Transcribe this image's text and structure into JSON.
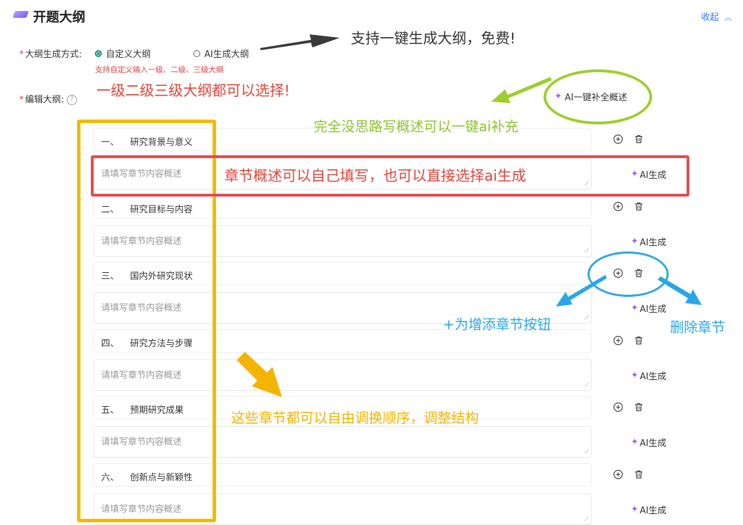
{
  "header": {
    "title": "开题大纲",
    "collapse_label": "收起"
  },
  "form": {
    "gen_mode_label": "大纲生成方式:",
    "option_custom": "自定义大纲",
    "option_ai": "AI生成大纲",
    "custom_hint": "支持自定义输入一级、二级、三级大纲",
    "edit_label": "编辑大纲:",
    "help_glyph": "?",
    "ai_complete_label": "AI一键补全概述"
  },
  "sections": [
    {
      "index": "一、",
      "title": "研究背景与意义"
    },
    {
      "index": "二、",
      "title": "研究目标与内容"
    },
    {
      "index": "三、",
      "title": "国内外研究现状"
    },
    {
      "index": "四、",
      "title": "研究方法与步骤"
    },
    {
      "index": "五、",
      "title": "预期研究成果"
    },
    {
      "index": "六、",
      "title": "创新点与新颖性"
    }
  ],
  "desc_placeholder": "请填写章节内容概述",
  "ai_generate_label": "AI生成",
  "annotations": {
    "one_click": "支持一键生成大纲，免费!",
    "levels": "一级二级三级大纲都可以选择!",
    "no_idea": "完全没思路写概述可以一键ai补充",
    "chapter_desc": "章节概述可以自己填写，也可以直接选择ai生成",
    "add_button": "+为增添章节按钮",
    "delete_chapter": "删除章节",
    "reorder": "这些章节都可以自由调换顺序，调整结构"
  },
  "colors": {
    "accent": "#0f8f7a",
    "link": "#2f7cf6",
    "annotation_red": "#e8484e",
    "annotation_green": "#9ccf2c",
    "annotation_blue": "#2aa7e6",
    "annotation_yellow": "#f5b800",
    "sparkle": "#a55cf0"
  },
  "icons": {
    "add": "plus-circle-icon",
    "delete": "trash-icon",
    "ai": "sparkle-icon",
    "collapse": "chevron-up-icon"
  }
}
